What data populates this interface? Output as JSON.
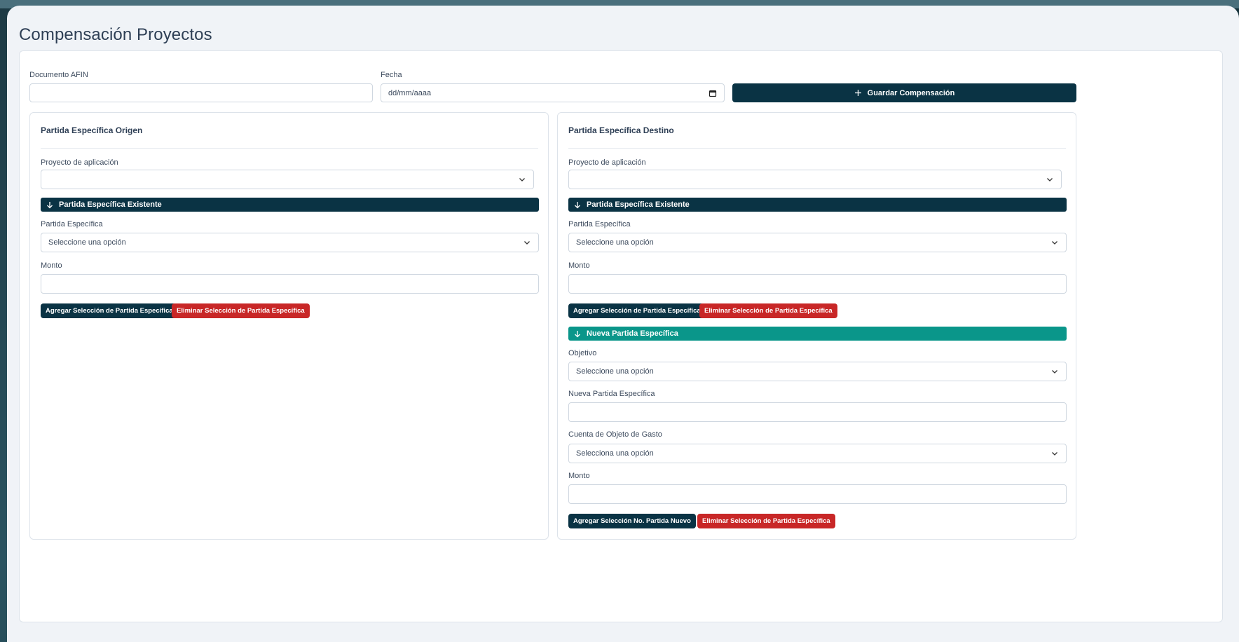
{
  "page": {
    "title": "Compensación Proyectos"
  },
  "form": {
    "documento_label": "Documento AFIN",
    "documento_value": "",
    "fecha_label": "Fecha",
    "fecha_placeholder": "dd/mm/aaaa",
    "guardar_label": "Guardar Compensación"
  },
  "origen": {
    "title": "Partida Específica Origen",
    "proyecto_label": "Proyecto de aplicación",
    "proyecto_value": "",
    "existente_bar": "Partida Específica Existente",
    "partida_label": "Partida Específica",
    "partida_value": "Seleccione una opción",
    "monto_label": "Monto",
    "monto_value": "",
    "agregar_label": "Agregar Selección de Partida Específica",
    "eliminar_label": "Eliminar Selección de Partida Específica"
  },
  "destino": {
    "title": "Partida Específica Destino",
    "proyecto_label": "Proyecto de aplicación",
    "proyecto_value": "",
    "existente_bar": "Partida Específica Existente",
    "partida_label": "Partida Específica",
    "partida_value": "Seleccione una opción",
    "monto_label": "Monto",
    "monto_value": "",
    "agregar_label": "Agregar Selección de Partida Específica",
    "eliminar_label": "Eliminar Selección de Partida Específica",
    "nueva_bar": "Nueva Partida Específica",
    "objetivo_label": "Objetivo",
    "objetivo_value": "Seleccione una opción",
    "nueva_partida_label": "Nueva Partida Específica",
    "nueva_partida_value": "",
    "cuenta_label": "Cuenta de Objeto de Gasto",
    "cuenta_value": "Selecciona una opción",
    "monto2_label": "Monto",
    "monto2_value": "",
    "agregar_nuevo_label": "Agregar Selección No. Partida Nuevo",
    "eliminar2_label": "Eliminar Selección de Partida Específica"
  },
  "colors": {
    "primary": "#0a3344",
    "teal": "#0a968a",
    "danger": "#c82727"
  },
  "icons": {
    "guardar": "plus-icon",
    "bar": "arrow-down-icon",
    "select": "chevron-down-icon",
    "date": "calendar-icon"
  }
}
